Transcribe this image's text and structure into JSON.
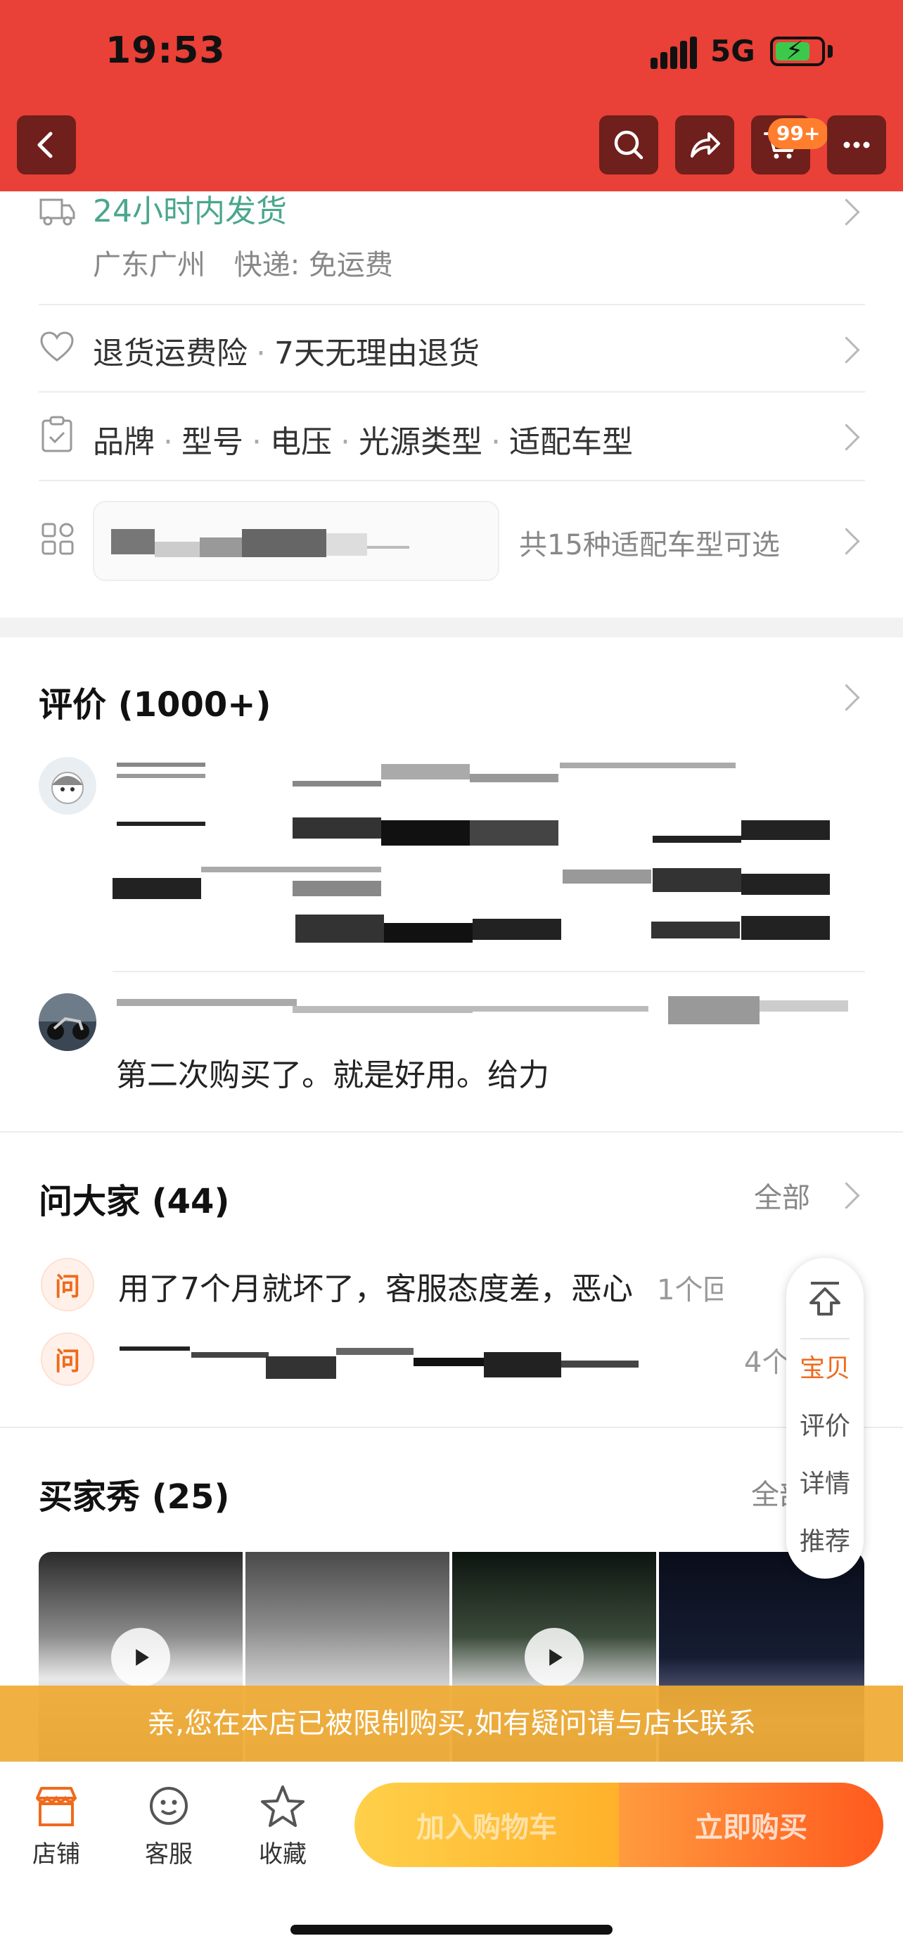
{
  "status_bar": {
    "time": "19:53",
    "network": "5G"
  },
  "nav": {
    "cart_badge": "99+"
  },
  "shipping": {
    "headline": "24小时内发货",
    "origin": "广东广州",
    "courier": "快递: 免运费"
  },
  "service": {
    "insurance": "退货运费险",
    "returns": "7天无理由退货"
  },
  "params": {
    "items": [
      "品牌",
      "型号",
      "电压",
      "光源类型",
      "适配车型"
    ]
  },
  "variants": {
    "summary": "共15种适配车型可选"
  },
  "reviews": {
    "title": "评价 (1000+)",
    "second_text": "第二次购买了。就是好用。给力"
  },
  "qa": {
    "title": "问大家 (44)",
    "all_link": "全部",
    "q_badge": "问",
    "q1_text": "用了7个月就坏了，客服态度差，恶心",
    "q1_count": "1个回",
    "q2_count": "4个"
  },
  "side_menu": {
    "items": [
      "宝贝",
      "评价",
      "详情",
      "推荐"
    ],
    "active": "宝贝"
  },
  "buyer_show": {
    "title": "买家秀 (25)",
    "all_link": "全部"
  },
  "notice": "亲,您在本店已被限制购买,如有疑问请与店长联系",
  "bottom_bar": {
    "shop": "店铺",
    "service": "客服",
    "favorite": "收藏",
    "add_to_cart": "加入购物车",
    "buy_now": "立即购买"
  },
  "colors": {
    "header_red": "#e94037",
    "accent_orange": "#f06a1c",
    "green": "#4aa68c"
  }
}
